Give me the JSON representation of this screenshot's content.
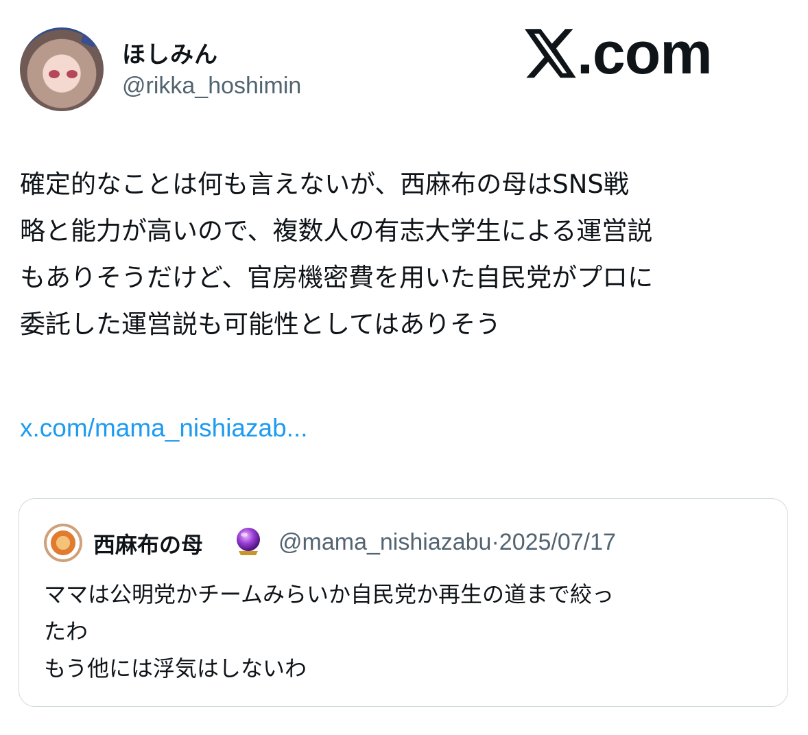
{
  "author": {
    "display_name": "ほしみん",
    "handle": "@rikka_hoshimin",
    "avatar_icon": "anime-girl-avatar"
  },
  "brand": {
    "logo_icon": "x-logo",
    "text": ".com"
  },
  "tweet": {
    "lines": [
      "確定的なことは何も言えないが、西麻布の母はSNS戦",
      "略と能力が高いので、複数人の有志大学生による運営説",
      "もありそうだけど、官房機密費を用いた自民党がプロに",
      "委託した運営説も可能性としてはありそう"
    ],
    "link": "x.com/mama_nishiazab..."
  },
  "quoted_tweet": {
    "display_name": "西麻布の母",
    "badge_icon": "crystal-ball-icon",
    "handle": "@mama_nishiazabu",
    "separator": "·",
    "date": "2025/07/17",
    "lines": [
      "ママは公明党かチームみらいか自民党か再生の道まで絞っ",
      "たわ",
      "もう他には浮気はしないわ"
    ]
  }
}
